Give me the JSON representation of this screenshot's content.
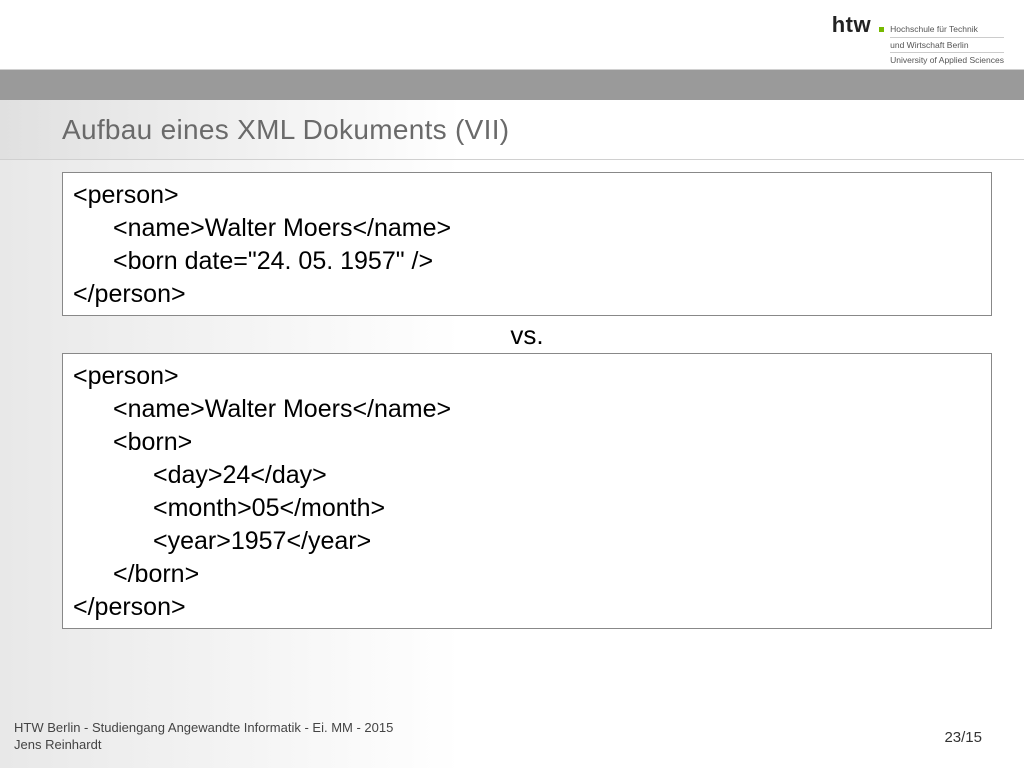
{
  "logo": {
    "brand": "htw",
    "line1": "Hochschule für Technik",
    "line2": "und Wirtschaft Berlin",
    "line3": "University of Applied Sciences"
  },
  "title": "Aufbau eines XML Dokuments (VII)",
  "code1": {
    "l1": "<person>",
    "l2": "<name>Walter Moers</name>",
    "l3": "<born date=\"24. 05. 1957\" />",
    "l4": "</person>"
  },
  "vs": "vs.",
  "code2": {
    "l1": "<person>",
    "l2": "<name>Walter Moers</name>",
    "l3": "<born>",
    "l4": "<day>24</day>",
    "l5": "<month>05</month>",
    "l6": "<year>1957</year>",
    "l7": "</born>",
    "l8": "</person>"
  },
  "footer": {
    "line1": "HTW Berlin - Studiengang Angewandte Informatik - Ei. MM - 2015",
    "line2": "Jens Reinhardt"
  },
  "page": "23/15"
}
